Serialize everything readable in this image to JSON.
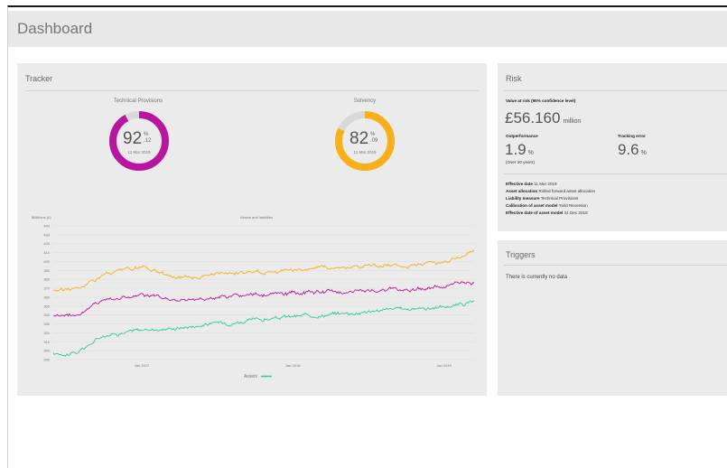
{
  "header": {
    "title": "Dashboard"
  },
  "tracker": {
    "title": "Tracker",
    "gauges": [
      {
        "title": "Technical Provisions",
        "value": "92",
        "pct": "%",
        "sub": ".12",
        "date": "11 Mar 2019",
        "fraction": 0.92,
        "color": "#b8169e"
      },
      {
        "title": "Solvency",
        "value": "82",
        "pct": "%",
        "sub": ".09",
        "date": "11 Mar 2019",
        "fraction": 0.82,
        "color": "#f7b01a"
      }
    ]
  },
  "chart_data": {
    "type": "line",
    "title": "Assets and liabilities",
    "ylabel": "$Millions (£)",
    "ylim": [
      290,
      440
    ],
    "yticks": [
      290,
      300,
      310,
      320,
      330,
      340,
      350,
      360,
      370,
      380,
      390,
      400,
      410,
      420,
      430,
      440
    ],
    "xlim": [
      "2016-06-01",
      "2019-03-15"
    ],
    "xticks": [
      {
        "date": "2017-01-01",
        "label": "Jan 2017"
      },
      {
        "date": "2018-01-01",
        "label": "Jan 2018"
      },
      {
        "date": "2019-01-01",
        "label": "Jan 2019"
      }
    ],
    "legend": {
      "label": "Assets",
      "color": "#2ecf8e",
      "placement": "bottom"
    },
    "series": [
      {
        "name": "Assets",
        "color": "#2ecf8e",
        "x": [
          "2016-06-01",
          "2016-08-01",
          "2016-10-01",
          "2017-01-01",
          "2017-04-01",
          "2017-07-01",
          "2017-10-01",
          "2018-01-01",
          "2018-04-01",
          "2018-07-01",
          "2018-10-01",
          "2019-01-01",
          "2019-03-15"
        ],
        "values": [
          296,
          298,
          318,
          323,
          326,
          331,
          334,
          338,
          341,
          344,
          347,
          349,
          354
        ]
      },
      {
        "color": "#b8169e",
        "x": [
          "2016-06-01",
          "2016-08-01",
          "2016-10-01",
          "2017-01-01",
          "2017-04-01",
          "2017-07-01",
          "2017-10-01",
          "2018-01-01",
          "2018-04-01",
          "2018-07-01",
          "2018-10-01",
          "2019-01-01",
          "2019-03-15"
        ],
        "values": [
          340,
          341,
          358,
          362,
          356,
          360,
          362,
          364,
          366,
          367,
          369,
          372,
          377
        ]
      },
      {
        "color": "#f7b01a",
        "x": [
          "2016-06-01",
          "2016-08-01",
          "2016-10-01",
          "2017-01-01",
          "2017-04-01",
          "2017-07-01",
          "2017-10-01",
          "2018-01-01",
          "2018-04-01",
          "2018-07-01",
          "2018-10-01",
          "2019-01-01",
          "2019-03-15"
        ],
        "values": [
          368,
          370,
          385,
          393,
          382,
          386,
          388,
          391,
          393,
          395,
          396,
          400,
          410
        ]
      }
    ]
  },
  "risk": {
    "title": "Risk",
    "var_label": "Value at risk (95% confidence level)",
    "var_value": "£56.160",
    "var_unit": "million",
    "outperformance_label": "Outperformance",
    "outperformance_value": "1.9",
    "outperformance_unit": "%",
    "outperformance_sub": "(Over 20 years)",
    "tracking_label": "Tracking error",
    "tracking_value": "9.6",
    "tracking_unit": "%",
    "details": [
      {
        "label": "Effective date",
        "value": "11 Mar 2019"
      },
      {
        "label": "Asset allocation",
        "value": "Rolled forward asset allocation"
      },
      {
        "label": "Liability measure",
        "value": "Technical Provisions"
      },
      {
        "label": "Calibration of asset model",
        "value": "Yield Reversion"
      },
      {
        "label": "Effective date of asset model",
        "value": "31 Dec 2018"
      }
    ]
  },
  "triggers": {
    "title": "Triggers",
    "empty_text": "There is currently no data"
  }
}
